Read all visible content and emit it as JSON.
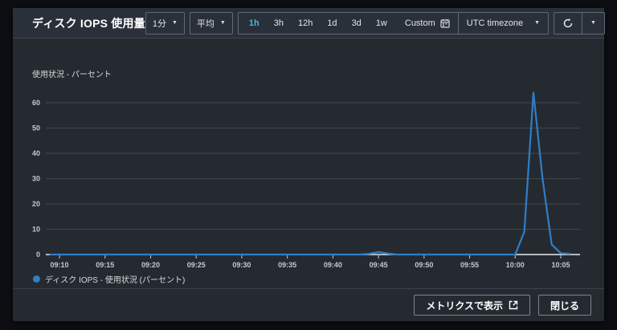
{
  "dialog": {
    "title": "ディスク IOPS 使用量",
    "period_dropdown": "1分",
    "statistic_dropdown": "平均",
    "time_ranges": [
      "1h",
      "3h",
      "12h",
      "1d",
      "3d",
      "1w"
    ],
    "active_time_range": "1h",
    "custom_label": "Custom",
    "timezone_dropdown": "UTC timezone",
    "footer": {
      "view_in_metrics_label": "メトリクスで表示",
      "close_label": "閉じる"
    }
  },
  "colors": {
    "accent_active_range": "#44b9d6",
    "line_blue": "#2e7fc7",
    "grid": "#42474e",
    "axis": "#e7e9e9",
    "tick_text": "#c3c9ce"
  },
  "chart_data": {
    "type": "line",
    "title": "",
    "ylabel": "使用状況 - パーセント",
    "xlabel": "",
    "ylim": [
      0,
      65
    ],
    "yticks": [
      0,
      10,
      20,
      30,
      40,
      50,
      60
    ],
    "xticks": [
      "09:10",
      "09:15",
      "09:20",
      "09:25",
      "09:30",
      "09:35",
      "09:40",
      "09:45",
      "09:50",
      "09:55",
      "10:00",
      "10:05"
    ],
    "grid": true,
    "legend_position": "bottom-left",
    "legend": [
      {
        "label": "ディスク IOPS - 使用状況 (パーセント)",
        "color": "#2e7fc7"
      }
    ],
    "series": [
      {
        "name": "ディスク IOPS - 使用状況 (パーセント)",
        "color": "#2e7fc7",
        "x_start": "09:09",
        "step_minutes": 1,
        "values": [
          0,
          0,
          0,
          0,
          0,
          0,
          0,
          0,
          0,
          0,
          0,
          0,
          0,
          0,
          0,
          0,
          0,
          0,
          0,
          0,
          0,
          0,
          0,
          0,
          0,
          0,
          0,
          0,
          0,
          0,
          0,
          0,
          0,
          0,
          0,
          0.3,
          1,
          0.4,
          0,
          0,
          0,
          0,
          0,
          0,
          0,
          0,
          0,
          0,
          0,
          0,
          0,
          0,
          9,
          64,
          30,
          4,
          0.5,
          0.3
        ]
      }
    ]
  }
}
